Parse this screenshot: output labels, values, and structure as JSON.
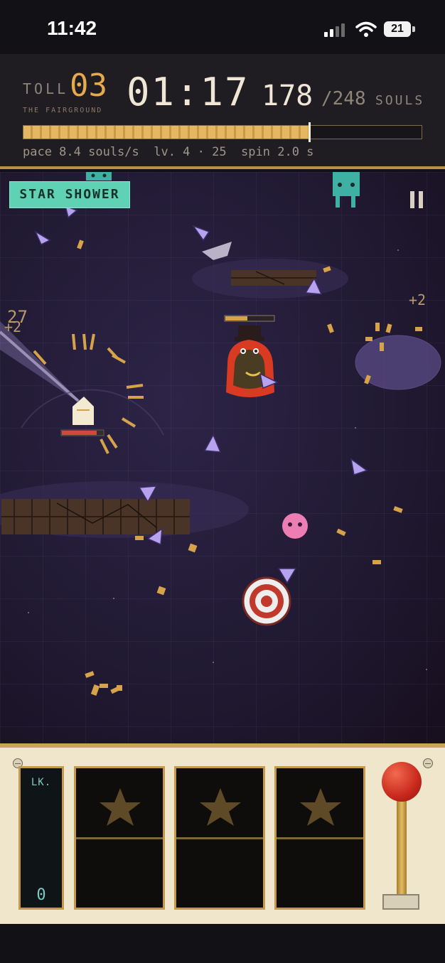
{
  "status_bar": {
    "time": "11:42",
    "battery": "21",
    "signal_icon": "cellular-signal-icon",
    "wifi_icon": "wifi-icon",
    "battery_icon": "battery-icon"
  },
  "hud": {
    "toll_label": "TOLL",
    "toll_value": "03",
    "venue": "THE FAIRGROUND",
    "timer": "01:17",
    "souls_collected": "178",
    "souls_total": "/248",
    "souls_label": "SOULS",
    "souls_progress_fraction": 0.718,
    "stats_line": "pace 8.4 souls/s  lv. 4 · 25  spin 2.0 s"
  },
  "arena": {
    "banner": "STAR SHOWER",
    "pause_icon": "pause-icon",
    "floating_texts": [
      "+2",
      "27",
      "+2"
    ],
    "player_health_fraction": 0.85,
    "boss_health_fraction": 0.45
  },
  "slot_machine": {
    "lock_label": "LK.",
    "lock_value": "0",
    "reels": [
      {
        "top_icon": "star-icon"
      },
      {
        "top_icon": "star-icon"
      },
      {
        "top_icon": "star-icon"
      }
    ],
    "lever_icon": "lever-icon"
  },
  "colors": {
    "accent_gold": "#e5a94f",
    "banner_teal": "#5fd1b5",
    "arena_purple": "#211a33",
    "panel_cream": "#efe6cc",
    "lever_red": "#c8281c"
  }
}
